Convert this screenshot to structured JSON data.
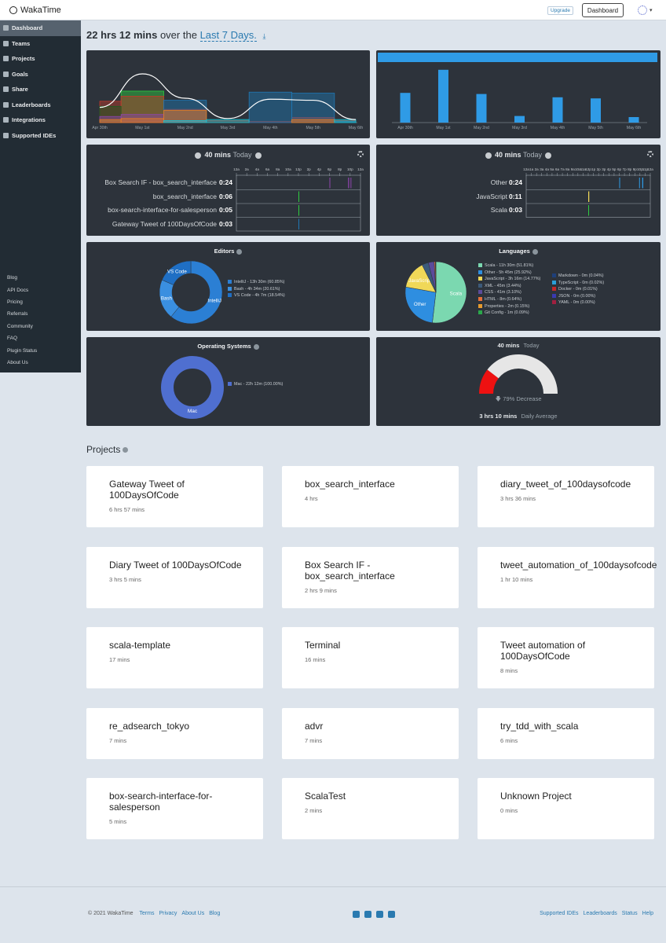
{
  "topbar": {
    "brand": "WakaTime",
    "upgrade": "Upgrade",
    "dashboard": "Dashboard"
  },
  "sidebar": {
    "items": [
      {
        "label": "Dashboard",
        "icon": "dashboard-icon"
      },
      {
        "label": "Teams",
        "icon": "teams-icon"
      },
      {
        "label": "Projects",
        "icon": "projects-icon"
      },
      {
        "label": "Goals",
        "icon": "goals-icon"
      },
      {
        "label": "Share",
        "icon": "share-icon"
      },
      {
        "label": "Leaderboards",
        "icon": "trophy-icon"
      },
      {
        "label": "Integrations",
        "icon": "wrench-icon"
      },
      {
        "label": "Supported IDEs",
        "icon": "circle-icon"
      }
    ],
    "links": [
      "Blog",
      "API Docs",
      "Pricing",
      "Referrals",
      "Community",
      "FAQ",
      "Plugin Status",
      "About Us"
    ]
  },
  "headline": {
    "total": "22 hrs 12 mins",
    "over": "over the",
    "range": "Last 7 Days."
  },
  "activity_chart": {
    "type": "area",
    "x": [
      "Apr 30th",
      "May 1st",
      "May 2nd",
      "May 3rd",
      "May 4th",
      "May 5th",
      "May 6th"
    ],
    "series": [
      {
        "color": "#2ecc40",
        "values": [
          0.2,
          3.1,
          0,
          0,
          0,
          0,
          0
        ]
      },
      {
        "color": "#c0392b",
        "values": [
          2.1,
          2.6,
          1.3,
          0.2,
          0.1,
          0.5,
          0.2
        ]
      },
      {
        "color": "#1b5e20",
        "values": [
          1.6,
          0,
          0,
          0,
          0,
          0,
          0
        ]
      },
      {
        "color": "#1f77b4",
        "values": [
          0,
          0,
          2.2,
          0,
          3.0,
          2.9,
          0.1
        ]
      },
      {
        "color": "#8e44ad",
        "values": [
          0.6,
          0.8,
          0.2,
          0,
          0,
          0,
          0
        ]
      },
      {
        "color": "#e67e22",
        "values": [
          0.3,
          0.4,
          1.2,
          0,
          0,
          0.3,
          0
        ]
      },
      {
        "color": "#17becf",
        "values": [
          0,
          0,
          0.2,
          0.3,
          0,
          0,
          0.3
        ]
      }
    ]
  },
  "daily_bar_chart": {
    "type": "bar",
    "x": [
      "Apr 30th",
      "May 1st",
      "May 2nd",
      "May 3rd",
      "May 4th",
      "May 5th",
      "May 6th"
    ],
    "values": [
      2.7,
      4.8,
      2.6,
      0.6,
      2.3,
      2.2,
      0.5
    ],
    "ylim": [
      0,
      5.5
    ]
  },
  "projects_today": {
    "total": "40 mins",
    "label": "Today",
    "rows": [
      {
        "name": "Box Search IF - box_search_interface",
        "time": "0:24"
      },
      {
        "name": "box_search_interface",
        "time": "0:06"
      },
      {
        "name": "box-search-interface-for-salesperson",
        "time": "0:05"
      },
      {
        "name": "Gateway Tweet of 100DaysOfCode",
        "time": "0:03"
      }
    ],
    "ticks": [
      "12a",
      "2a",
      "4a",
      "6a",
      "8a",
      "10a",
      "12p",
      "2p",
      "4p",
      "6p",
      "8p",
      "10p",
      "12a"
    ]
  },
  "languages_today": {
    "total": "40 mins",
    "label": "Today",
    "rows": [
      {
        "name": "Other",
        "time": "0:24"
      },
      {
        "name": "JavaScript",
        "time": "0:11"
      },
      {
        "name": "Scala",
        "time": "0:03"
      }
    ],
    "ticks": [
      "12a",
      "1a",
      "2a",
      "3a",
      "4a",
      "5a",
      "6a",
      "7a",
      "8a",
      "9a",
      "10a",
      "11a",
      "12p",
      "1p",
      "2p",
      "3p",
      "4p",
      "5p",
      "6p",
      "7p",
      "8p",
      "9p",
      "10p",
      "11p",
      "12a"
    ]
  },
  "editors": {
    "title": "Editors",
    "chart_data": {
      "type": "pie",
      "labels": [
        "IntelliJ",
        "Bash",
        "VS Code"
      ],
      "values": [
        60.85,
        20.61,
        18.54
      ],
      "colors": [
        "#2b7fd4",
        "#3a8fe0",
        "#1f6fc4"
      ]
    },
    "legend": [
      "IntelliJ - 13h 30m (60.85%)",
      "Bash - 4h 34m (20.61%)",
      "VS Code - 4h 7m (18.54%)"
    ]
  },
  "languages": {
    "title": "Languages",
    "chart_data": {
      "type": "pie",
      "labels": [
        "Scala",
        "Other",
        "JavaScript",
        "XML",
        "CSS",
        "HTML",
        "Properties",
        "Git Config"
      ],
      "values": [
        51.81,
        25.92,
        14.77,
        3.44,
        3.1,
        0.64,
        0.15,
        0.09
      ],
      "colors": [
        "#7bd8b0",
        "#2e8ee0",
        "#f0d858",
        "#3c5a7a",
        "#5b4b9b",
        "#e6703a",
        "#e69b2e",
        "#2aa84a"
      ]
    },
    "legend_left": [
      {
        "text": "Scala - 11h 30m (51.81%)",
        "color": "#7bd8b0"
      },
      {
        "text": "Other - 5h 45m (25.92%)",
        "color": "#2e8ee0"
      },
      {
        "text": "JavaScript - 3h 16m (14.77%)",
        "color": "#f0d858"
      },
      {
        "text": "XML - 45m (3.44%)",
        "color": "#3c5a7a"
      },
      {
        "text": "CSS - 41m (3.10%)",
        "color": "#5b4b9b"
      },
      {
        "text": "HTML - 8m (0.64%)",
        "color": "#e6703a"
      },
      {
        "text": "Properties - 2m (0.15%)",
        "color": "#e69b2e"
      },
      {
        "text": "Git Config - 1m (0.09%)",
        "color": "#2aa84a"
      }
    ],
    "legend_right": [
      {
        "text": "Markdown - 0m (0.04%)",
        "color": "#1e3f7a"
      },
      {
        "text": "TypeScript - 0m (0.02%)",
        "color": "#2a9fd8"
      },
      {
        "text": "Docker - 0m (0.01%)",
        "color": "#c42a2a"
      },
      {
        "text": "JSON - 0m (0.00%)",
        "color": "#3a3ab0"
      },
      {
        "text": "YAML - 0m (0.00%)",
        "color": "#a02040"
      }
    ]
  },
  "os": {
    "title": "Operating Systems",
    "chart_data": {
      "type": "pie",
      "labels": [
        "Mac"
      ],
      "values": [
        100
      ],
      "colors": [
        "#4f6fd0"
      ]
    },
    "legend": "Mac - 22h 12m (100.00%)"
  },
  "gauge": {
    "total": "40 mins",
    "label": "Today",
    "decrease": "79% Decrease",
    "average": "3 hrs 10 mins",
    "average_label": "Daily Average",
    "fraction": 0.21
  },
  "projects": {
    "title": "Projects",
    "cards": [
      {
        "name": "Gateway Tweet of 100DaysOfCode",
        "name1": "Gateway Tweet of",
        "name2": "100DaysOfCode",
        "time": "6 hrs 57 mins"
      },
      {
        "name1": "box_search_interface",
        "name2": "",
        "time": "4 hrs"
      },
      {
        "name1": "diary_tweet_of_100daysofcode",
        "name2": "",
        "time": "3 hrs 36 mins"
      },
      {
        "name1": "Diary Tweet of 100DaysOfCode",
        "name2": "",
        "time": "3 hrs 5 mins"
      },
      {
        "name1": "Box Search IF -",
        "name2": "box_search_interface",
        "time": "2 hrs 9 mins"
      },
      {
        "name1": "tweet_automation_of_100daysofcode",
        "name2": "",
        "time": "1 hr 10 mins"
      },
      {
        "name1": "scala-template",
        "name2": "",
        "time": "17 mins"
      },
      {
        "name1": "Terminal",
        "name2": "",
        "time": "16 mins"
      },
      {
        "name1": "Tweet automation of",
        "name2": "100DaysOfCode",
        "time": "8 mins"
      },
      {
        "name1": "re_adsearch_tokyo",
        "name2": "",
        "time": "7 mins"
      },
      {
        "name1": "advr",
        "name2": "",
        "time": "7 mins"
      },
      {
        "name1": "try_tdd_with_scala",
        "name2": "",
        "time": "6 mins"
      },
      {
        "name1": "box-search-interface-for-",
        "name2": "salesperson",
        "time": "5 mins"
      },
      {
        "name1": "ScalaTest",
        "name2": "",
        "time": "2 mins"
      },
      {
        "name1": "Unknown Project",
        "name2": "",
        "time": "0 mins"
      }
    ]
  },
  "footer": {
    "copyright": "© 2021 WakaTime",
    "left": [
      "Terms",
      "Privacy",
      "About Us",
      "Blog"
    ],
    "right": [
      "Supported IDEs",
      "Leaderboards",
      "Status",
      "Help"
    ]
  }
}
